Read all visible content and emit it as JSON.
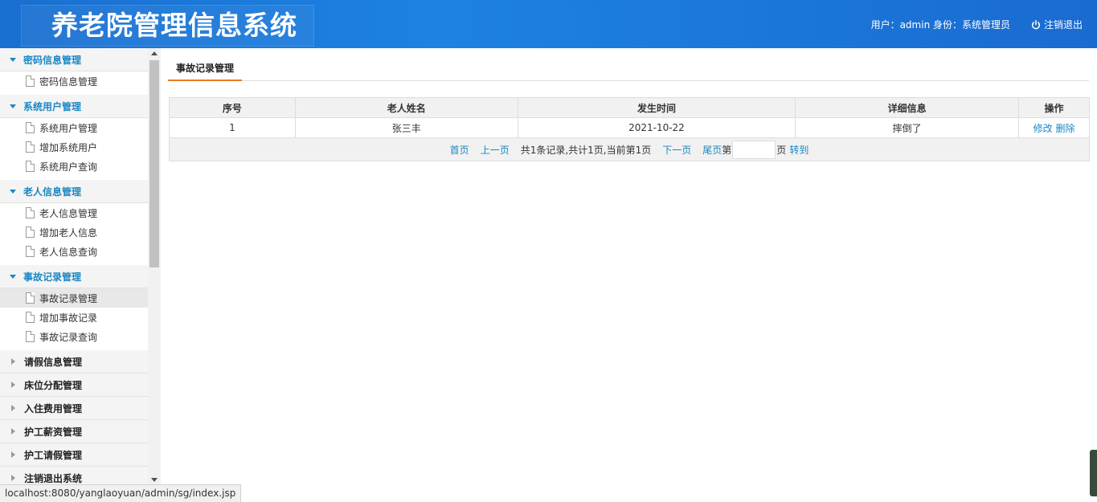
{
  "header": {
    "title": "养老院管理信息系统",
    "user_info": "用户：admin 身份：系统管理员",
    "logout_label": "注销退出"
  },
  "sidebar": {
    "groups": [
      {
        "label": "密码信息管理",
        "items": [
          "密码信息管理"
        ]
      },
      {
        "label": "系统用户管理",
        "items": [
          "系统用户管理",
          "增加系统用户",
          "系统用户查询"
        ]
      },
      {
        "label": "老人信息管理",
        "items": [
          "老人信息管理",
          "增加老人信息",
          "老人信息查询"
        ]
      },
      {
        "label": "事故记录管理",
        "items": [
          "事故记录管理",
          "增加事故记录",
          "事故记录查询"
        ]
      },
      {
        "label": "请假信息管理"
      },
      {
        "label": "床位分配管理"
      },
      {
        "label": "入住费用管理"
      },
      {
        "label": "护工薪资管理"
      },
      {
        "label": "护工请假管理"
      },
      {
        "label": "注销退出系统"
      }
    ]
  },
  "main": {
    "tab": "事故记录管理",
    "table": {
      "headers": [
        "序号",
        "老人姓名",
        "发生时间",
        "详细信息",
        "操作"
      ],
      "rows": [
        {
          "no": "1",
          "name": "张三丰",
          "time": "2021-10-22",
          "detail": "摔倒了",
          "edit": "修改",
          "delete": "删除"
        }
      ]
    },
    "pager": {
      "first": "首页",
      "prev": "上一页",
      "info": "共1条记录,共计1页,当前第1页",
      "next": "下一页",
      "last": "尾页",
      "page_prefix": "第",
      "page_suffix": "页",
      "goto": "转到",
      "page_input_value": ""
    }
  },
  "statusbar": {
    "url": "localhost:8080/yanglaoyuan/admin/sg/index.jsp"
  },
  "colors": {
    "header": "#1d82e2",
    "link": "#1b87c4",
    "tab_accent": "#ef7a1f"
  }
}
